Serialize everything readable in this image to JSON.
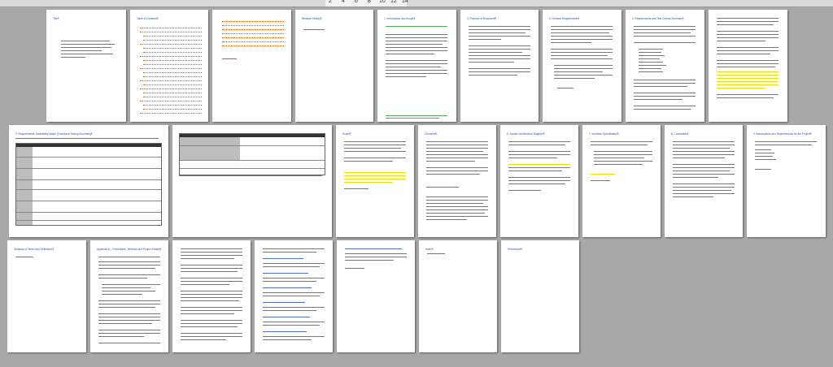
{
  "ruler": {
    "ticks": [
      "2",
      "4",
      "6",
      "8",
      "10",
      "12",
      "14"
    ]
  },
  "pages": [
    {
      "id": 1,
      "heading": "Title¶"
    },
    {
      "id": 2,
      "heading": "Table of Contents¶"
    },
    {
      "id": 3,
      "heading": ""
    },
    {
      "id": 4,
      "heading": "Revision History¶"
    },
    {
      "id": 5,
      "heading": "1. Introduction and Scope¶"
    },
    {
      "id": 6,
      "heading": "2. Purpose of Document¶"
    },
    {
      "id": 7,
      "heading": "3. General Requirements¶"
    },
    {
      "id": 8,
      "heading": "4. Requirements and Test Criteria Summary¶"
    },
    {
      "id": 9,
      "heading": ""
    },
    {
      "id": 10,
      "heading": "5. Requirements Traceability Matrix (Functional Testing Summary)¶"
    },
    {
      "id": 11,
      "heading": ""
    },
    {
      "id": 12,
      "heading": "Scope¶"
    },
    {
      "id": 13,
      "heading": "Overview¶"
    },
    {
      "id": 14,
      "heading": "6. System Architecture Diagram¶"
    },
    {
      "id": 15,
      "heading": "7. Interface Specification¶"
    },
    {
      "id": 16,
      "heading": "8. Constraints¶"
    },
    {
      "id": 17,
      "heading": "9. Assumptions and Dependencies for the Project¶"
    },
    {
      "id": 18,
      "heading": "Glossary of Terms and Definitions¶"
    },
    {
      "id": 19,
      "heading": "Appendix A – Procedures, Methods and Project Details¶"
    },
    {
      "id": 20,
      "heading": ""
    },
    {
      "id": 21,
      "heading": ""
    },
    {
      "id": 22,
      "heading": ""
    },
    {
      "id": 23,
      "heading": "Index¶"
    },
    {
      "id": 24,
      "heading": "References¶"
    }
  ]
}
